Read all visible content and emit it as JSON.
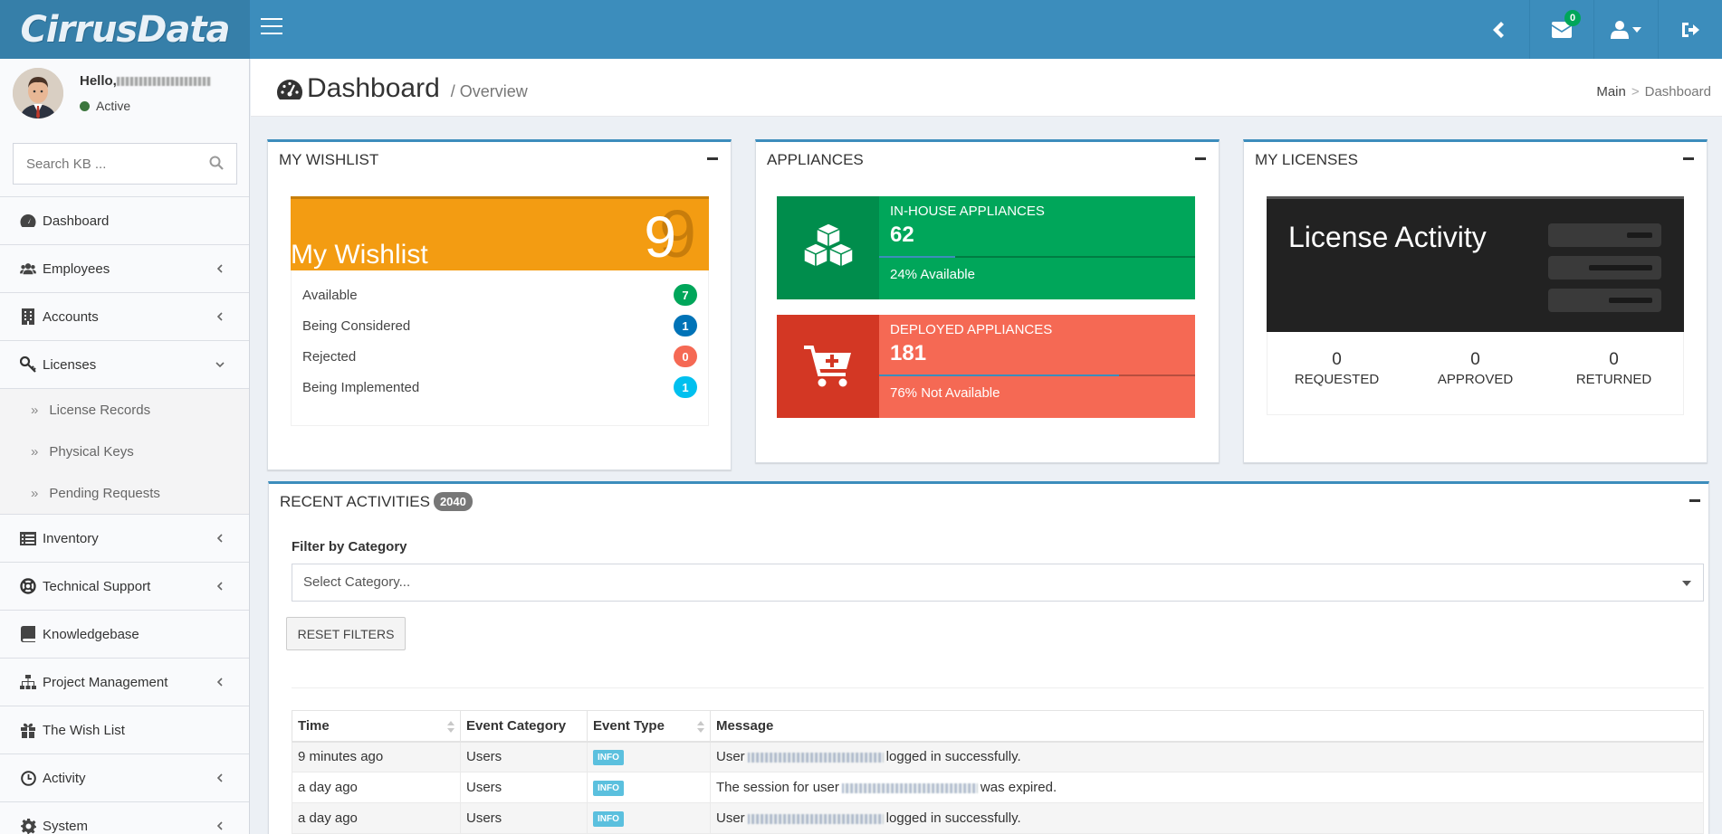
{
  "app": {
    "logo_text": "CirrusData"
  },
  "topbar": {
    "mail_count": "0",
    "icons": [
      "hamburger-icon",
      "chevron-left-icon",
      "envelope-icon",
      "user-icon",
      "sign-out-icon"
    ]
  },
  "user": {
    "hello": "Hello,",
    "status": "Active",
    "status_color": "#3c763d"
  },
  "search": {
    "placeholder": "Search KB ..."
  },
  "sidebar": {
    "items": [
      {
        "label": "Dashboard",
        "icon": "dashboard-icon"
      },
      {
        "label": "Employees",
        "icon": "users-icon"
      },
      {
        "label": "Accounts",
        "icon": "building-icon"
      },
      {
        "label": "Licenses",
        "icon": "key-icon"
      },
      {
        "label": "Inventory",
        "icon": "list-alt-icon"
      },
      {
        "label": "Technical Support",
        "icon": "life-ring-icon"
      },
      {
        "label": "Knowledgebase",
        "icon": "book-icon"
      },
      {
        "label": "Project Management",
        "icon": "sitemap-icon"
      },
      {
        "label": "The Wish List",
        "icon": "gift-icon"
      },
      {
        "label": "Activity",
        "icon": "clock-icon"
      },
      {
        "label": "System",
        "icon": "cog-icon"
      }
    ],
    "licenses_sub": [
      "License Records",
      "Physical Keys",
      "Pending Requests"
    ]
  },
  "header": {
    "title": "Dashboard",
    "subtitle": "/ Overview",
    "breadcrumb": [
      "Main",
      "Dashboard"
    ]
  },
  "wishlist": {
    "title": "MY WISHLIST",
    "heading": "My Wishlist",
    "total": "9",
    "rows": [
      {
        "label": "Available",
        "count": "7",
        "color": "#00a65a"
      },
      {
        "label": "Being Considered",
        "count": "1",
        "color": "#0073b7"
      },
      {
        "label": "Rejected",
        "count": "0",
        "color": "#f56954"
      },
      {
        "label": "Being Implemented",
        "count": "1",
        "color": "#00c0ef"
      }
    ]
  },
  "appliances": {
    "title": "APPLIANCES",
    "inhouse": {
      "label": "IN-HOUSE APPLIANCES",
      "count": "62",
      "desc": "24% Available",
      "progress": 0.24,
      "color": "#00a65a",
      "icon_bg": "#008d4c"
    },
    "deployed": {
      "label": "DEPLOYED APPLIANCES",
      "count": "181",
      "desc": "76% Not Available",
      "progress": 0.76,
      "color": "#f56954",
      "icon_bg": "#d33724"
    }
  },
  "licenses": {
    "title": "MY LICENSES",
    "activity_title": "License Activity",
    "stats": [
      {
        "n": "0",
        "label": "REQUESTED"
      },
      {
        "n": "0",
        "label": "APPROVED"
      },
      {
        "n": "0",
        "label": "RETURNED"
      }
    ]
  },
  "activities": {
    "title": "RECENT ACTIVITIES",
    "count": "2040",
    "filter_label": "Filter by Category",
    "filter_placeholder": "Select Category...",
    "reset_label": "RESET FILTERS",
    "columns": [
      "Time",
      "Event Category",
      "Event Type",
      "Message"
    ],
    "rows": [
      {
        "time": "9 minutes ago",
        "category": "Users",
        "type": "INFO",
        "msg_pre": "User",
        "msg_post": "logged in successfully."
      },
      {
        "time": "a day ago",
        "category": "Users",
        "type": "INFO",
        "msg_pre": "The session for user",
        "msg_post": "was expired."
      },
      {
        "time": "a day ago",
        "category": "Users",
        "type": "INFO",
        "msg_pre": "User",
        "msg_post": "logged in successfully."
      }
    ]
  }
}
